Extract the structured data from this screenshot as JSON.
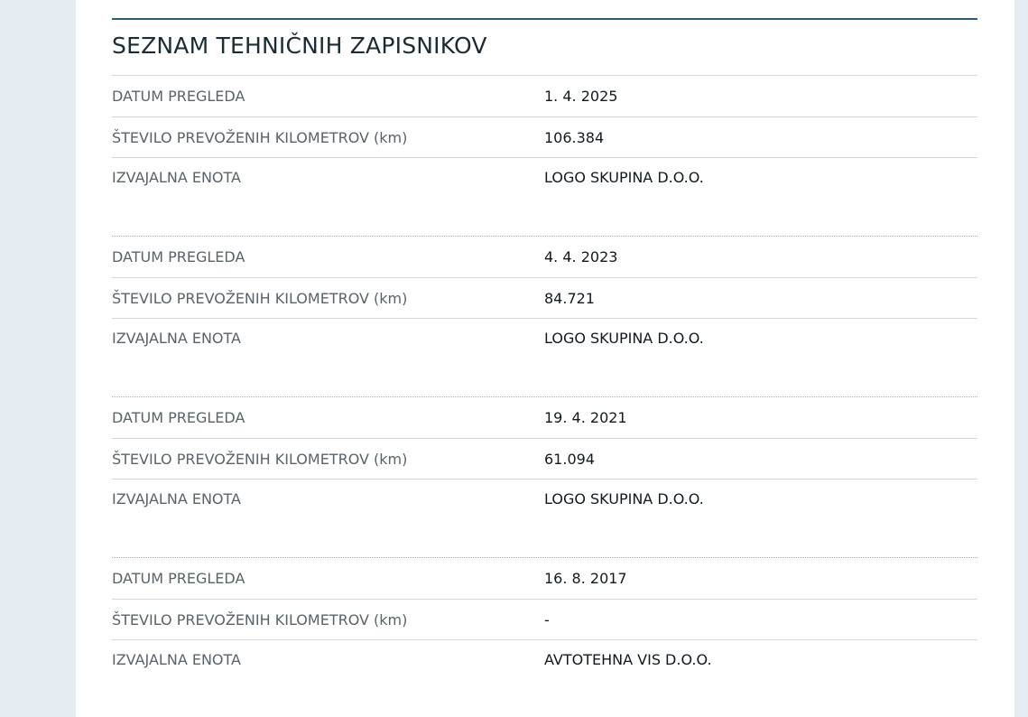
{
  "title": "SEZNAM TEHNIČNIH ZAPISNIKOV",
  "labels": {
    "date": "DATUM PREGLEDA",
    "km": "ŠTEVILO PREVOŽENIH KILOMETROV (km)",
    "unit": "IZVAJALNA ENOTA"
  },
  "records": [
    {
      "date": "1. 4. 2025",
      "km": "106.384",
      "unit": "LOGO SKUPINA D.O.O."
    },
    {
      "date": "4. 4. 2023",
      "km": "84.721",
      "unit": "LOGO SKUPINA D.O.O."
    },
    {
      "date": "19. 4. 2021",
      "km": "61.094",
      "unit": "LOGO SKUPINA D.O.O."
    },
    {
      "date": "16. 8. 2017",
      "km": "-",
      "unit": "AVTOTEHNA VIS D.O.O."
    }
  ]
}
